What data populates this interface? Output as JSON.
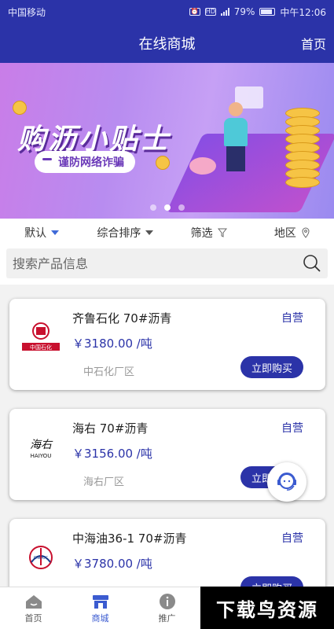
{
  "status_bar": {
    "carrier": "中国移动",
    "battery": "79%",
    "time": "中午12:06"
  },
  "header": {
    "title": "在线商城",
    "home_link": "首页"
  },
  "banner": {
    "headline": "购沥小贴士",
    "subline": "谨防网络诈骗",
    "slide_count": 3,
    "active_slide": 2
  },
  "filters": [
    {
      "label": "默认",
      "icon": "chevron-down-icon"
    },
    {
      "label": "综合排序",
      "icon": "chevron-down-icon"
    },
    {
      "label": "筛选",
      "icon": "filter-icon"
    },
    {
      "label": "地区",
      "icon": "location-icon"
    }
  ],
  "search": {
    "placeholder": "搜索产品信息"
  },
  "products": [
    {
      "name": "齐鲁石化 70#沥青",
      "badge": "自营",
      "price": "￥3180.00 /吨",
      "area": "中石化厂区",
      "action": "立即购买",
      "logo": "中国石化"
    },
    {
      "name": "海右 70#沥青",
      "badge": "自营",
      "price": "￥3156.00 /吨",
      "area": "海右厂区",
      "action": "立即购买",
      "logo": "海右",
      "logo_sub": "HAIYOU"
    },
    {
      "name": "中海油36-1 70#沥青",
      "badge": "自营",
      "price": "￥3780.00 /吨",
      "area": "",
      "action": "立即购买",
      "logo": "CNOOC"
    }
  ],
  "bottom_nav": [
    {
      "label": "首页",
      "icon": "home-icon"
    },
    {
      "label": "商城",
      "icon": "store-icon"
    },
    {
      "label": "推广",
      "icon": "info-icon"
    }
  ],
  "watermark": "下载鸟资源"
}
